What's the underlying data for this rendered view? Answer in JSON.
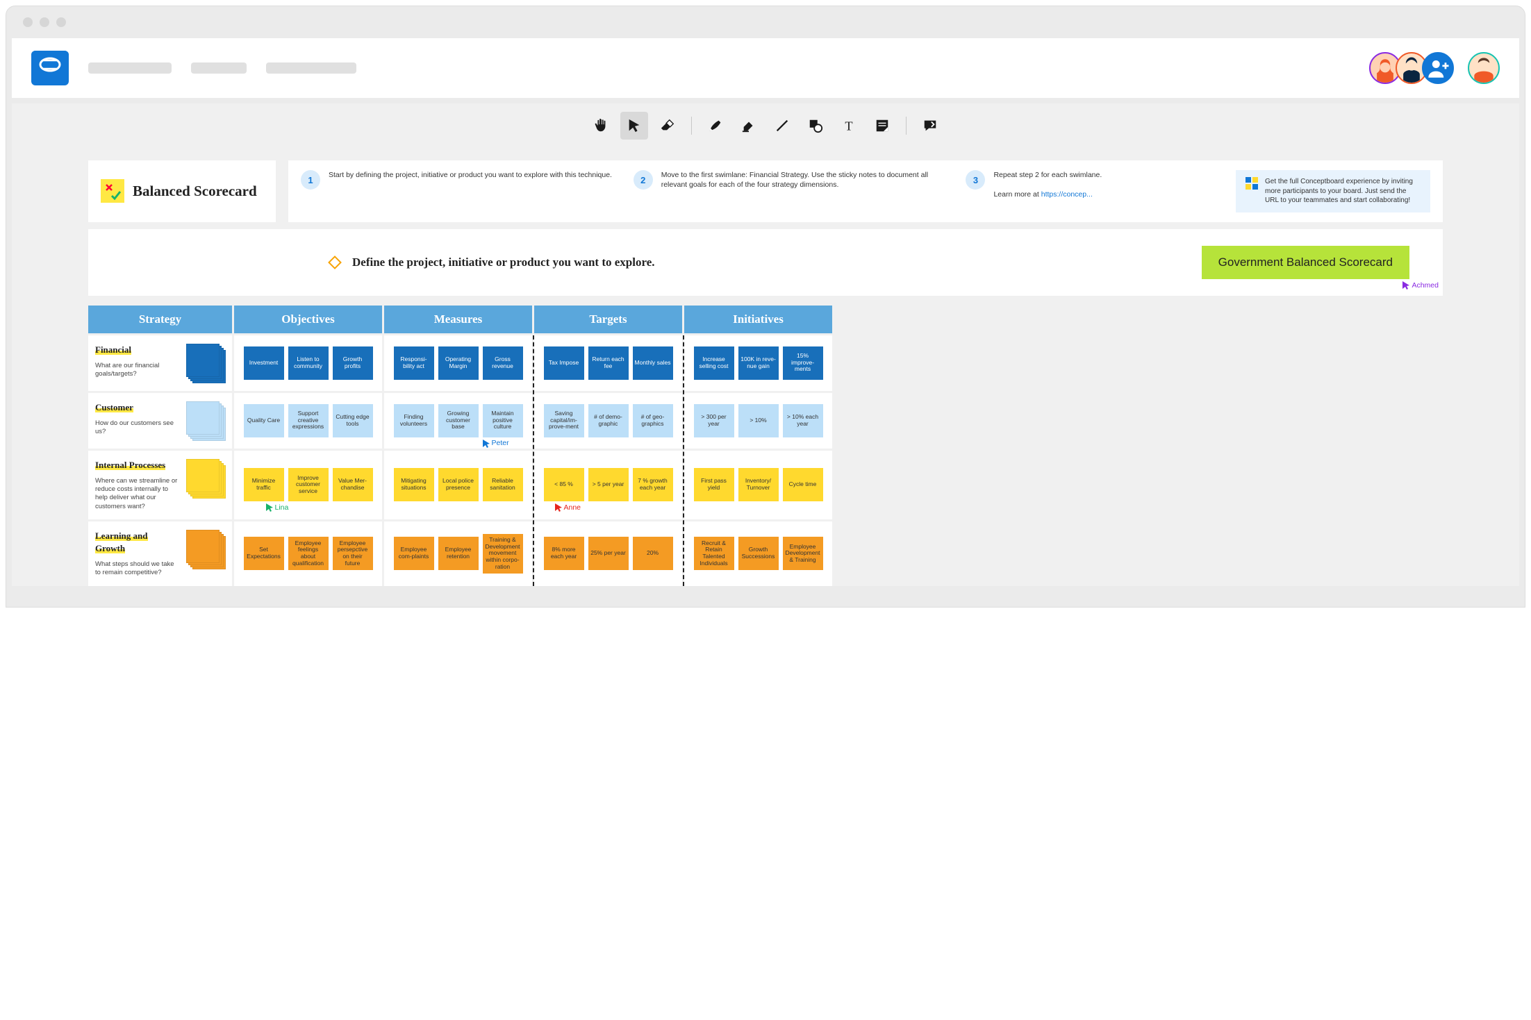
{
  "page_title": "Balanced Scorecard",
  "steps": [
    {
      "num": "1",
      "text": "Start by defining the project, initiative or product you want to explore with this technique."
    },
    {
      "num": "2",
      "text": "Move to the first swimlane: Financial Strategy. Use the sticky notes to document all relevant goals for each of the four strategy dimensions."
    },
    {
      "num": "3",
      "text": "Repeat step 2 for each swimlane.",
      "link_prefix": "Learn more at ",
      "link": "https://concep..."
    }
  ],
  "tip": "Get the full Conceptboard experience by inviting more participants to your board. Just send the URL to your teammates and start collaborating!",
  "define_prompt": "Define the project, initiative or product you want to explore.",
  "project_note": "Government Balanced Scorecard",
  "cursors": {
    "achmed": "Achmed",
    "peter": "Peter",
    "lina": "Lina",
    "anne": "Anne"
  },
  "headers": [
    "Strategy",
    "Objectives",
    "Measures",
    "Targets",
    "Initiatives"
  ],
  "lanes": [
    {
      "title": "Financial",
      "sub": "What are our financial goals/targets?",
      "color": "db",
      "objectives": [
        "Investment",
        "Listen to community",
        "Growth profits"
      ],
      "measures": [
        "Responsi-bility act",
        "Operating Margin",
        "Gross revenue"
      ],
      "targets": [
        "Tax Impose",
        "Return each fee",
        "Monthly sales"
      ],
      "initiatives": [
        "Increase selling cost",
        "100K in reve-nue gain",
        "15% improve-ments"
      ]
    },
    {
      "title": "Customer",
      "sub": "How do our customers see us?",
      "color": "lb",
      "objectives": [
        "Quality Care",
        "Support creative expressions",
        "Cutting edge tools"
      ],
      "measures": [
        "Finding volunteers",
        "Growing customer base",
        "Maintain positive culture"
      ],
      "targets": [
        "Saving capital/im-prove-ment",
        "# of demo-graphic",
        "# of geo-graphics"
      ],
      "initiatives": [
        "> 300 per year",
        "> 10%",
        "> 10% each year"
      ]
    },
    {
      "title": "Internal Processes",
      "sub": "Where can we streamline or reduce costs internally to help deliver what our customers want?",
      "color": "ye",
      "objectives": [
        "Minimize traffic",
        "Improve customer service",
        "Value Mer-chandise"
      ],
      "measures": [
        "Mitigating situations",
        "Local police presence",
        "Reliable sanitation"
      ],
      "targets": [
        "< 85 %",
        "> 5 per year",
        "7 % growth each year"
      ],
      "initiatives": [
        "First pass yield",
        "Inventory/ Turnover",
        "Cycle time"
      ]
    },
    {
      "title": "Learning and Growth",
      "sub": "What steps should we take to remain competitive?",
      "color": "or",
      "objectives": [
        "Set Expectations",
        "Employee feelings about qualification",
        "Employee persepctive on their future"
      ],
      "measures": [
        "Employee com-plaints",
        "Employee retention",
        "Training & Development movement within corpo-ration"
      ],
      "targets": [
        "8% more each year",
        "25% per year",
        "20%"
      ],
      "initiatives": [
        "Recruit & Retain Talented Individuals",
        "Growth Successions",
        "Employee Development & Training"
      ]
    }
  ]
}
